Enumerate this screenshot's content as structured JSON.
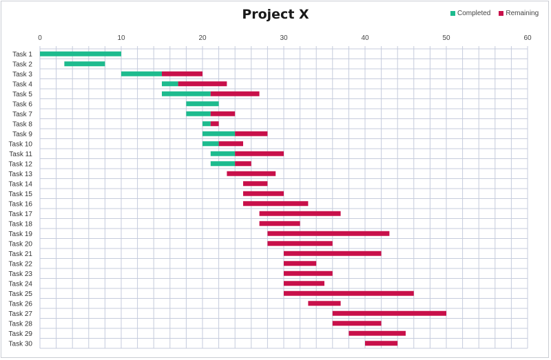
{
  "chart_data": {
    "type": "bar",
    "orientation": "horizontal-stacked-gantt",
    "title": "Project X",
    "xlabel": "",
    "ylabel": "",
    "xlim": [
      0,
      60
    ],
    "xticks": [
      0,
      10,
      20,
      30,
      40,
      50,
      60
    ],
    "minor_grid_step": 2,
    "grid": true,
    "legend_position": "top-right",
    "legend": [
      {
        "name": "Completed",
        "color": "#1dbb8e"
      },
      {
        "name": "Remaining",
        "color": "#c8104a"
      }
    ],
    "categories": [
      "Task 1",
      "Task 2",
      "Task 3",
      "Task 4",
      "Task 5",
      "Task 6",
      "Task 7",
      "Task 8",
      "Task 9",
      "Task 10",
      "Task 11",
      "Task 12",
      "Task 13",
      "Task 14",
      "Task 15",
      "Task 16",
      "Task 17",
      "Task 18",
      "Task 19",
      "Task 20",
      "Task 21",
      "Task 22",
      "Task 23",
      "Task 24",
      "Task 25",
      "Task 26",
      "Task 27",
      "Task 28",
      "Task 29",
      "Task 30"
    ],
    "start": [
      0,
      3,
      10,
      15,
      15,
      18,
      18,
      20,
      20,
      20,
      21,
      21,
      23,
      25,
      25,
      25,
      27,
      27,
      28,
      28,
      30,
      30,
      30,
      30,
      30,
      33,
      36,
      36,
      38,
      40
    ],
    "series": [
      {
        "name": "Completed",
        "values": [
          10,
          5,
          5,
          2,
          6,
          4,
          3,
          1,
          4,
          2,
          3,
          3,
          0,
          0,
          0,
          0,
          0,
          0,
          0,
          0,
          0,
          0,
          0,
          0,
          0,
          0,
          0,
          0,
          0,
          0
        ]
      },
      {
        "name": "Remaining",
        "values": [
          0,
          0,
          5,
          6,
          6,
          0,
          3,
          1,
          4,
          3,
          6,
          2,
          6,
          3,
          5,
          8,
          10,
          5,
          15,
          8,
          12,
          4,
          6,
          5,
          16,
          4,
          14,
          6,
          7,
          4
        ]
      }
    ]
  }
}
